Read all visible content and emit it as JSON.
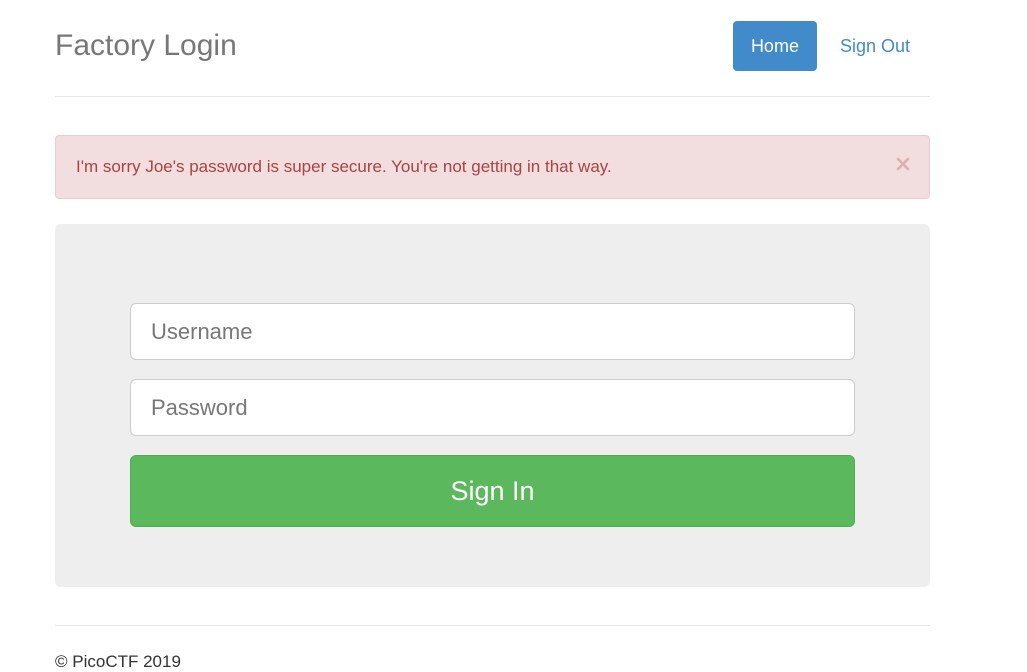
{
  "header": {
    "brand": "Factory Login",
    "nav": [
      {
        "label": "Home",
        "active": true
      },
      {
        "label": "Sign Out",
        "active": false
      }
    ]
  },
  "alert": {
    "message": "I'm sorry Joe's password is super secure. You're not getting in that way.",
    "close_icon": "close-icon",
    "type": "danger"
  },
  "form": {
    "username_placeholder": "Username",
    "username_value": "",
    "password_placeholder": "Password",
    "password_value": "",
    "submit_label": "Sign In"
  },
  "footer": {
    "text": "© PicoCTF 2019"
  },
  "colors": {
    "primary": "#428bca",
    "success": "#5cb85c",
    "danger_bg": "#f2dede",
    "danger_text": "#a94442",
    "jumbotron_bg": "#eeeeee"
  }
}
